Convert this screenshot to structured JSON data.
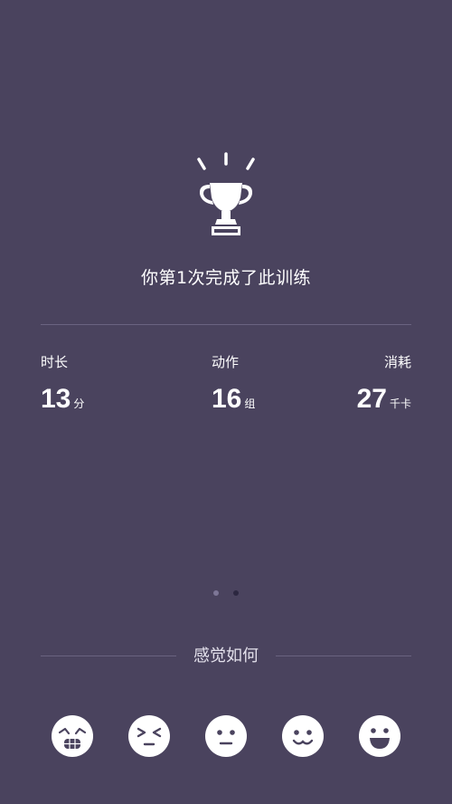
{
  "summary": {
    "headline": "你第1次完成了此训练"
  },
  "stats": [
    {
      "label": "时长",
      "value": "13",
      "unit": "分"
    },
    {
      "label": "动作",
      "value": "16",
      "unit": "组"
    },
    {
      "label": "消耗",
      "value": "27",
      "unit": "千卡"
    }
  ],
  "pager": {
    "total": 2,
    "current": 1
  },
  "feedback": {
    "title": "感觉如何",
    "options": [
      {
        "icon": "exhausted-face-icon"
      },
      {
        "icon": "struggling-face-icon"
      },
      {
        "icon": "neutral-face-icon"
      },
      {
        "icon": "content-face-icon"
      },
      {
        "icon": "happy-face-icon"
      }
    ]
  },
  "colors": {
    "background": "#4a435e",
    "divider": "#6a6380",
    "text": "#ffffff",
    "dot_active": "#7d7696",
    "dot_inactive": "#2c2740"
  }
}
